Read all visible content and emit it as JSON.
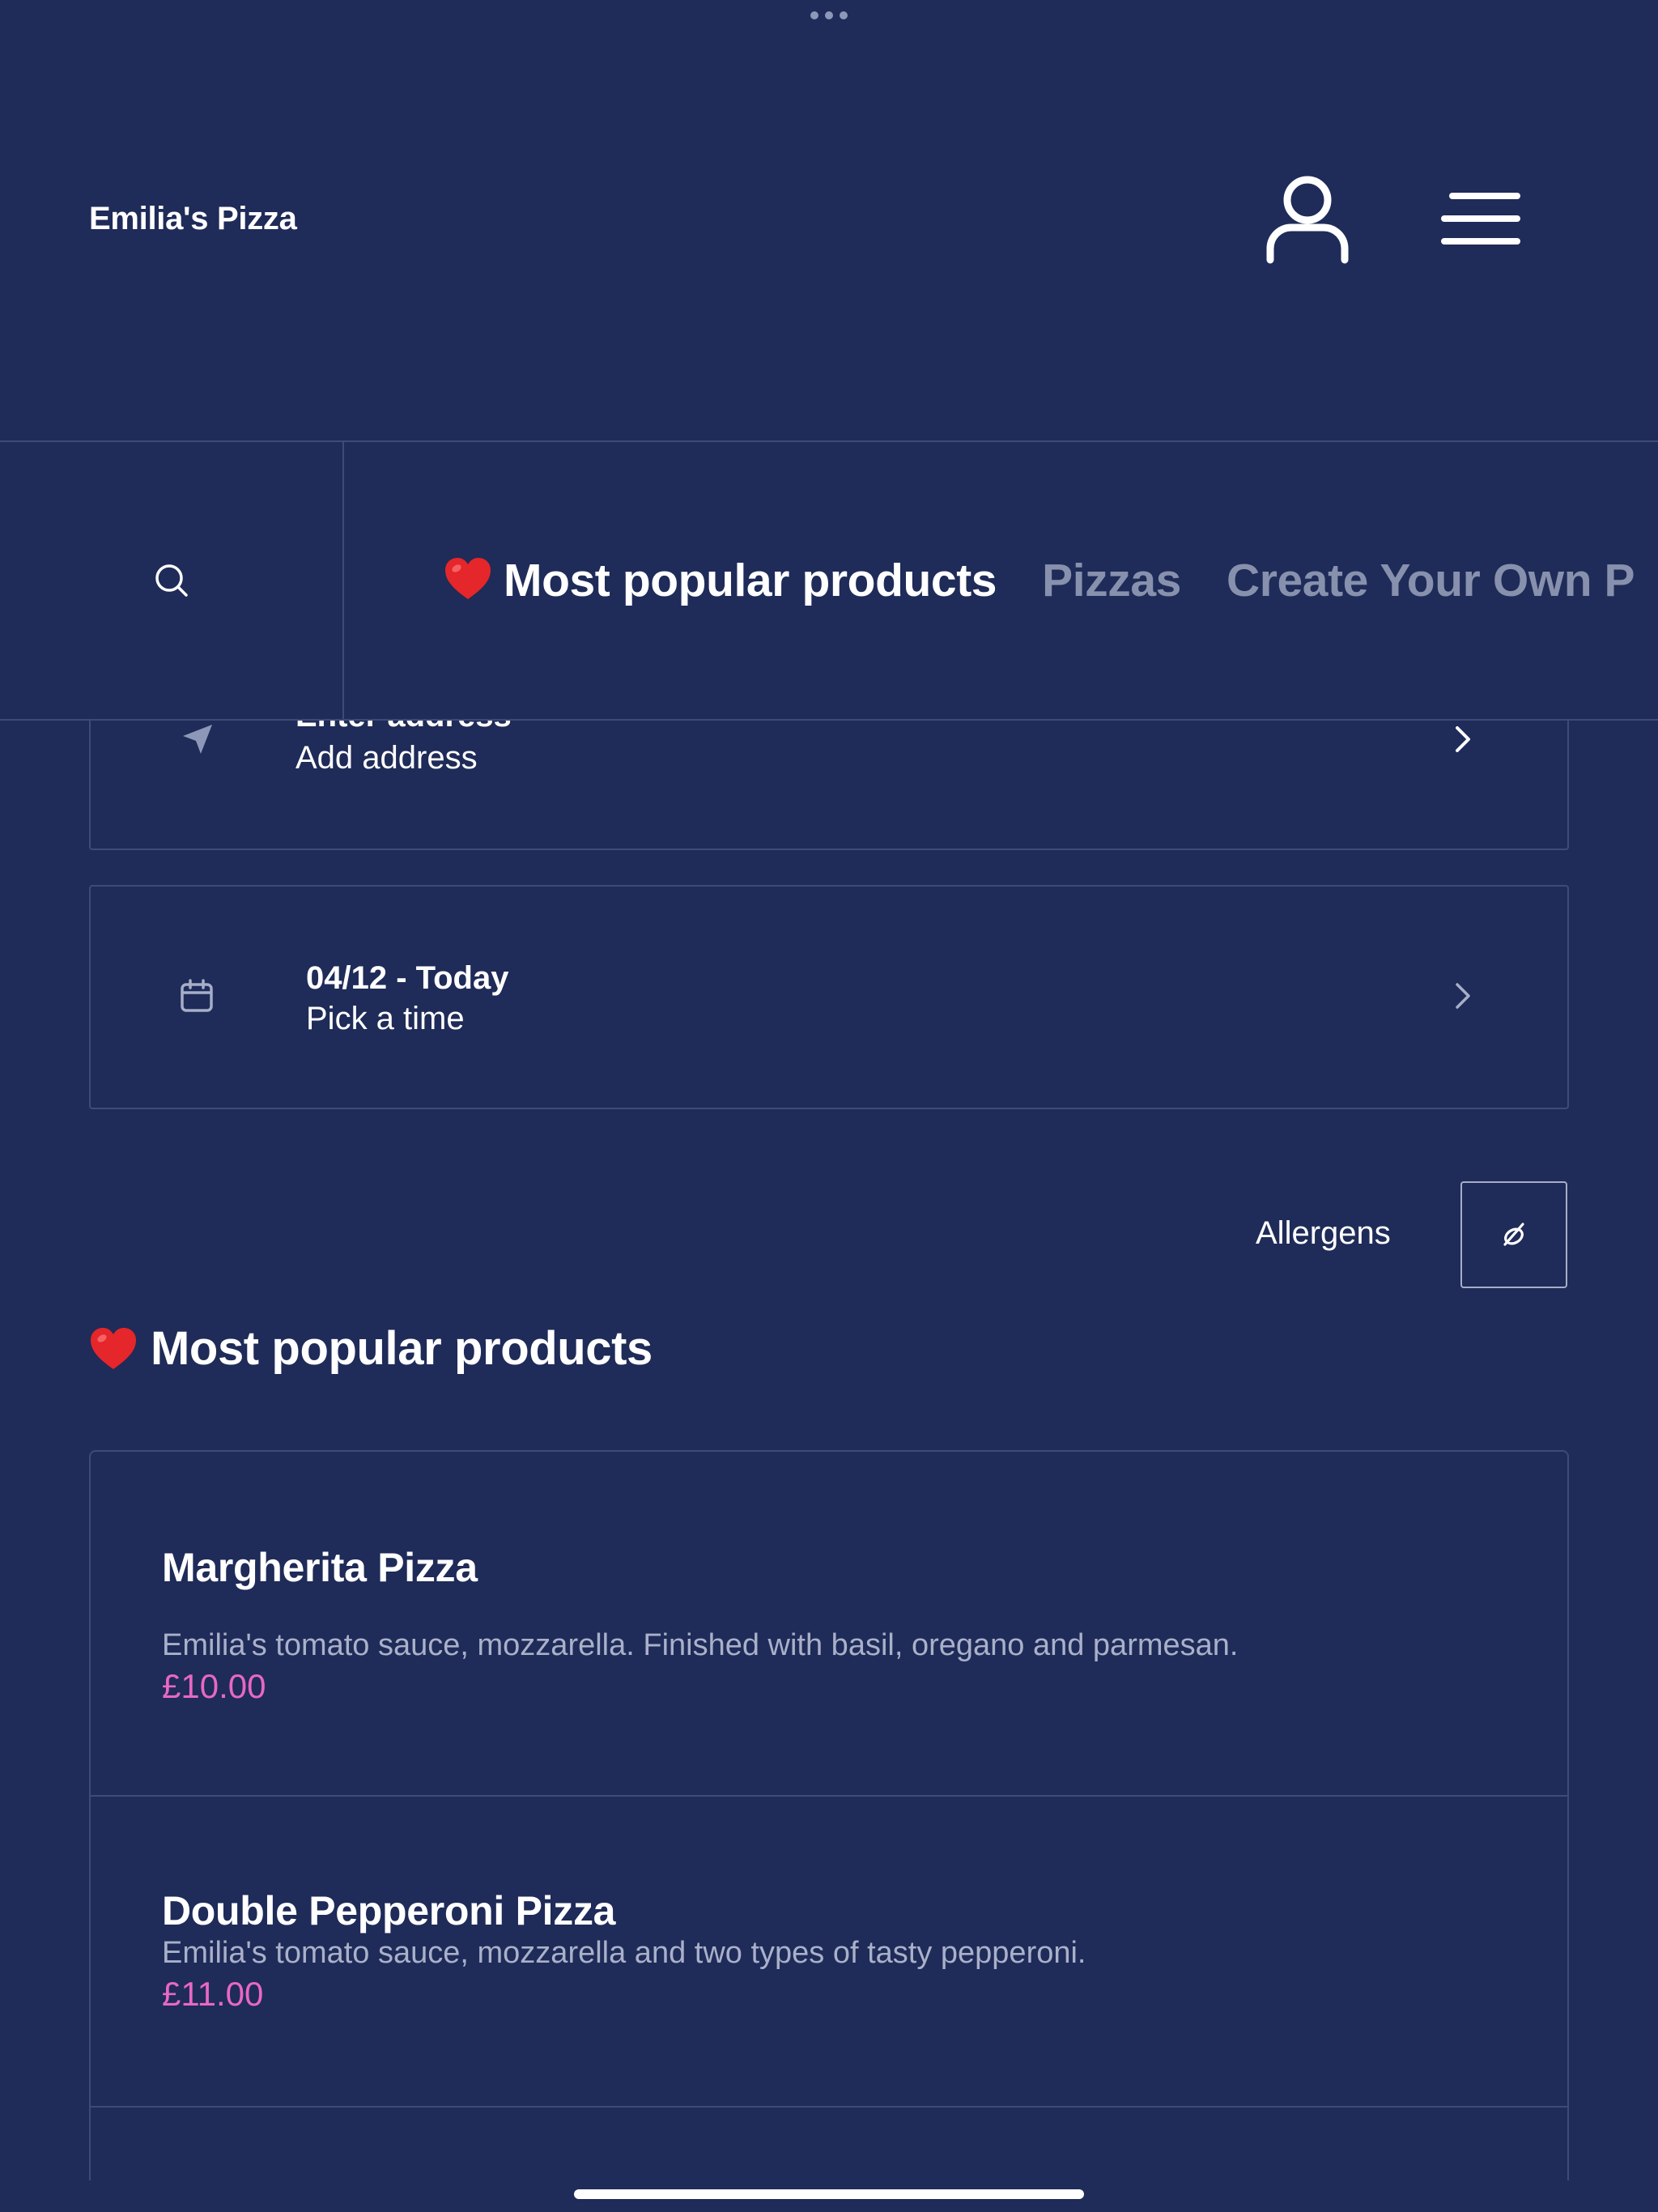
{
  "header": {
    "title": "Emilia's Pizza",
    "user_icon": "user-icon",
    "menu_icon": "hamburger-menu-icon"
  },
  "tabs": [
    {
      "label": "Most popular products",
      "emoji": "red-heart",
      "active": true
    },
    {
      "label": "Pizzas",
      "active": false
    },
    {
      "label": "Create Your Own P",
      "active": false
    }
  ],
  "address": {
    "title": "Enter address",
    "subtitle": "Add address",
    "icon": "location-arrow-icon"
  },
  "time": {
    "title": "04/12 - Today",
    "subtitle": "Pick a time",
    "icon": "calendar-icon"
  },
  "allergens": {
    "label": "Allergens",
    "icon": "allergen-filter-icon"
  },
  "section": {
    "title": "Most popular products"
  },
  "products": [
    {
      "name": "Margherita Pizza",
      "description": "Emilia's tomato sauce, mozzarella. Finished with basil, oregano and parmesan.",
      "price": "£10.00"
    },
    {
      "name": "Double Pepperoni Pizza",
      "description": "Emilia's tomato sauce, mozzarella and two types of tasty pepperoni.",
      "price": "£11.00"
    }
  ],
  "colors": {
    "background": "#1f2b58",
    "border": "#3e4b77",
    "price": "#e868c4",
    "muted_text": "#a9b0c9",
    "inactive_tab": "#8791ad"
  }
}
